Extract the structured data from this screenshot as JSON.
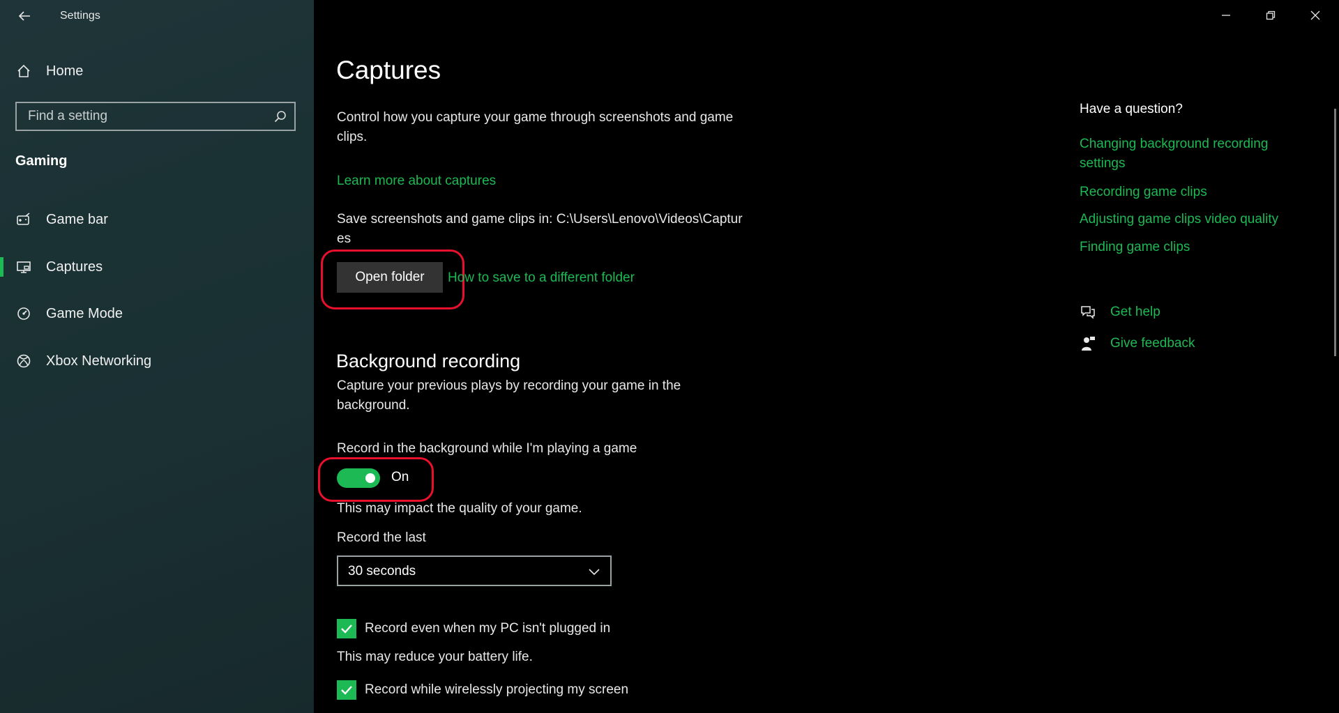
{
  "app": {
    "title": "Settings"
  },
  "sidebar": {
    "home_label": "Home",
    "search_placeholder": "Find a setting",
    "section": "Gaming",
    "items": [
      {
        "label": "Game bar",
        "icon": "game-bar-icon",
        "active": false
      },
      {
        "label": "Captures",
        "icon": "captures-icon",
        "active": true
      },
      {
        "label": "Game Mode",
        "icon": "game-mode-icon",
        "active": false
      },
      {
        "label": "Xbox Networking",
        "icon": "xbox-icon",
        "active": false
      }
    ]
  },
  "main": {
    "title": "Captures",
    "intro": "Control how you capture your game through screenshots and game clips.",
    "learn_more": "Learn more about captures",
    "save_location_text": "Save screenshots and game clips in: C:\\Users\\Lenovo\\Videos\\Captures",
    "open_folder_label": "Open folder",
    "different_folder_link": "How to save to a different folder",
    "background": {
      "heading": "Background recording",
      "description": "Capture your previous plays by recording your game in the background.",
      "record_label": "Record in the background while I'm playing a game",
      "toggle_state": "On",
      "impact_note": "This may impact the quality of your game.",
      "record_last_label": "Record the last",
      "record_last_value": "30 seconds",
      "checkbox1_label": "Record even when my PC isn't plugged in",
      "battery_note": "This may reduce your battery life.",
      "checkbox2_label": "Record while wirelessly projecting my screen"
    }
  },
  "help": {
    "heading": "Have a question?",
    "links": [
      "Changing background recording settings",
      "Recording game clips",
      "Adjusting game clips video quality",
      "Finding game clips"
    ],
    "get_help": "Get help",
    "give_feedback": "Give feedback"
  },
  "colors": {
    "accent": "#1db954",
    "highlight": "#e8112d"
  }
}
